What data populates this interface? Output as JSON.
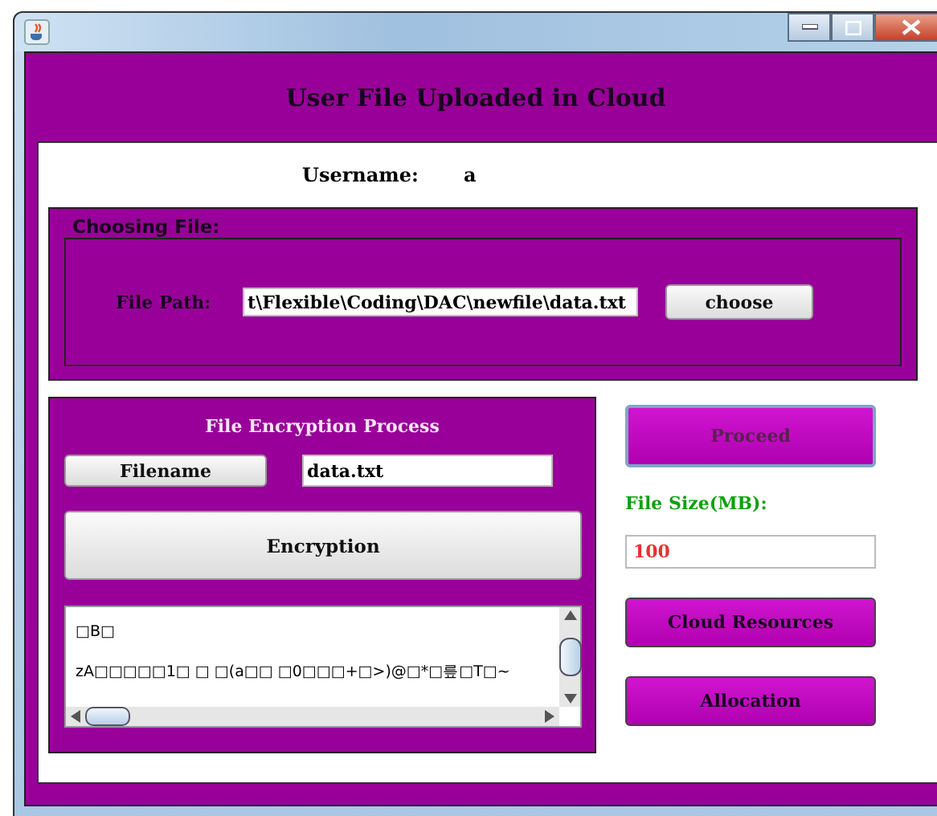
{
  "header": {
    "title": "User File Uploaded in Cloud"
  },
  "user": {
    "label": "Username:",
    "value": "a"
  },
  "choosing": {
    "legend": "Choosing File:",
    "path_label": "File Path:",
    "path_value": "t\\Flexible\\Coding\\DAC\\newfile\\data.txt",
    "choose_button": "choose"
  },
  "encryption": {
    "title": "File Encryption Process",
    "filename_button": "Filename",
    "filename_value": "data.txt",
    "encrypt_button": "Encryption",
    "output_lines": [
      "□B□",
      "zA□□□□□1□  □  □(a□□  □0□□□+□>)@□*□릎□T□~"
    ]
  },
  "side": {
    "proceed_button": "Proceed",
    "size_label": "File Size(MB):",
    "size_value": "100",
    "buttons": [
      "Cloud Resources",
      "Allocation"
    ]
  }
}
